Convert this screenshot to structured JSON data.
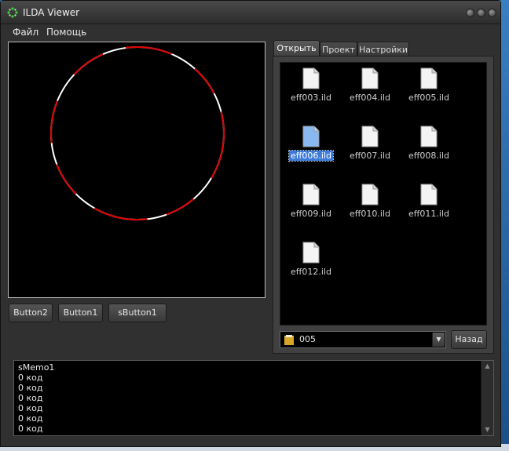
{
  "window": {
    "title": "ILDA Viewer",
    "app_icon": "ilda-logo-icon"
  },
  "menu": {
    "items": [
      "Файл",
      "Помощь"
    ]
  },
  "canvas": {
    "circle_colors": [
      "#ffffff",
      "#e00000"
    ]
  },
  "buttons": {
    "button2": "Button2",
    "button1": "Button1",
    "sbutton1": "sButton1"
  },
  "tabs": [
    {
      "label": "Открыть",
      "active": true
    },
    {
      "label": "Проект",
      "active": false
    },
    {
      "label": "Настройки",
      "active": false
    }
  ],
  "files": [
    {
      "name": "eff003.ild",
      "selected": false
    },
    {
      "name": "eff004.ild",
      "selected": false
    },
    {
      "name": "eff005.ild",
      "selected": false
    },
    {
      "name": "eff006.ild",
      "selected": true
    },
    {
      "name": "eff007.ild",
      "selected": false
    },
    {
      "name": "eff008.ild",
      "selected": false
    },
    {
      "name": "eff009.ild",
      "selected": false
    },
    {
      "name": "eff010.ild",
      "selected": false
    },
    {
      "name": "eff011.ild",
      "selected": false
    },
    {
      "name": "eff012.ild",
      "selected": false
    }
  ],
  "folder_combo": {
    "value": "005",
    "icon": "folder-icon"
  },
  "back_button": "Назад",
  "memo": {
    "lines": [
      "sMemo1",
      "0 код",
      "0 код",
      "0 код",
      "0 код",
      "0 код",
      "0 код"
    ]
  },
  "colors": {
    "selection": "#3d7bd8",
    "laser_red": "#e00000",
    "laser_white": "#ffffff"
  }
}
